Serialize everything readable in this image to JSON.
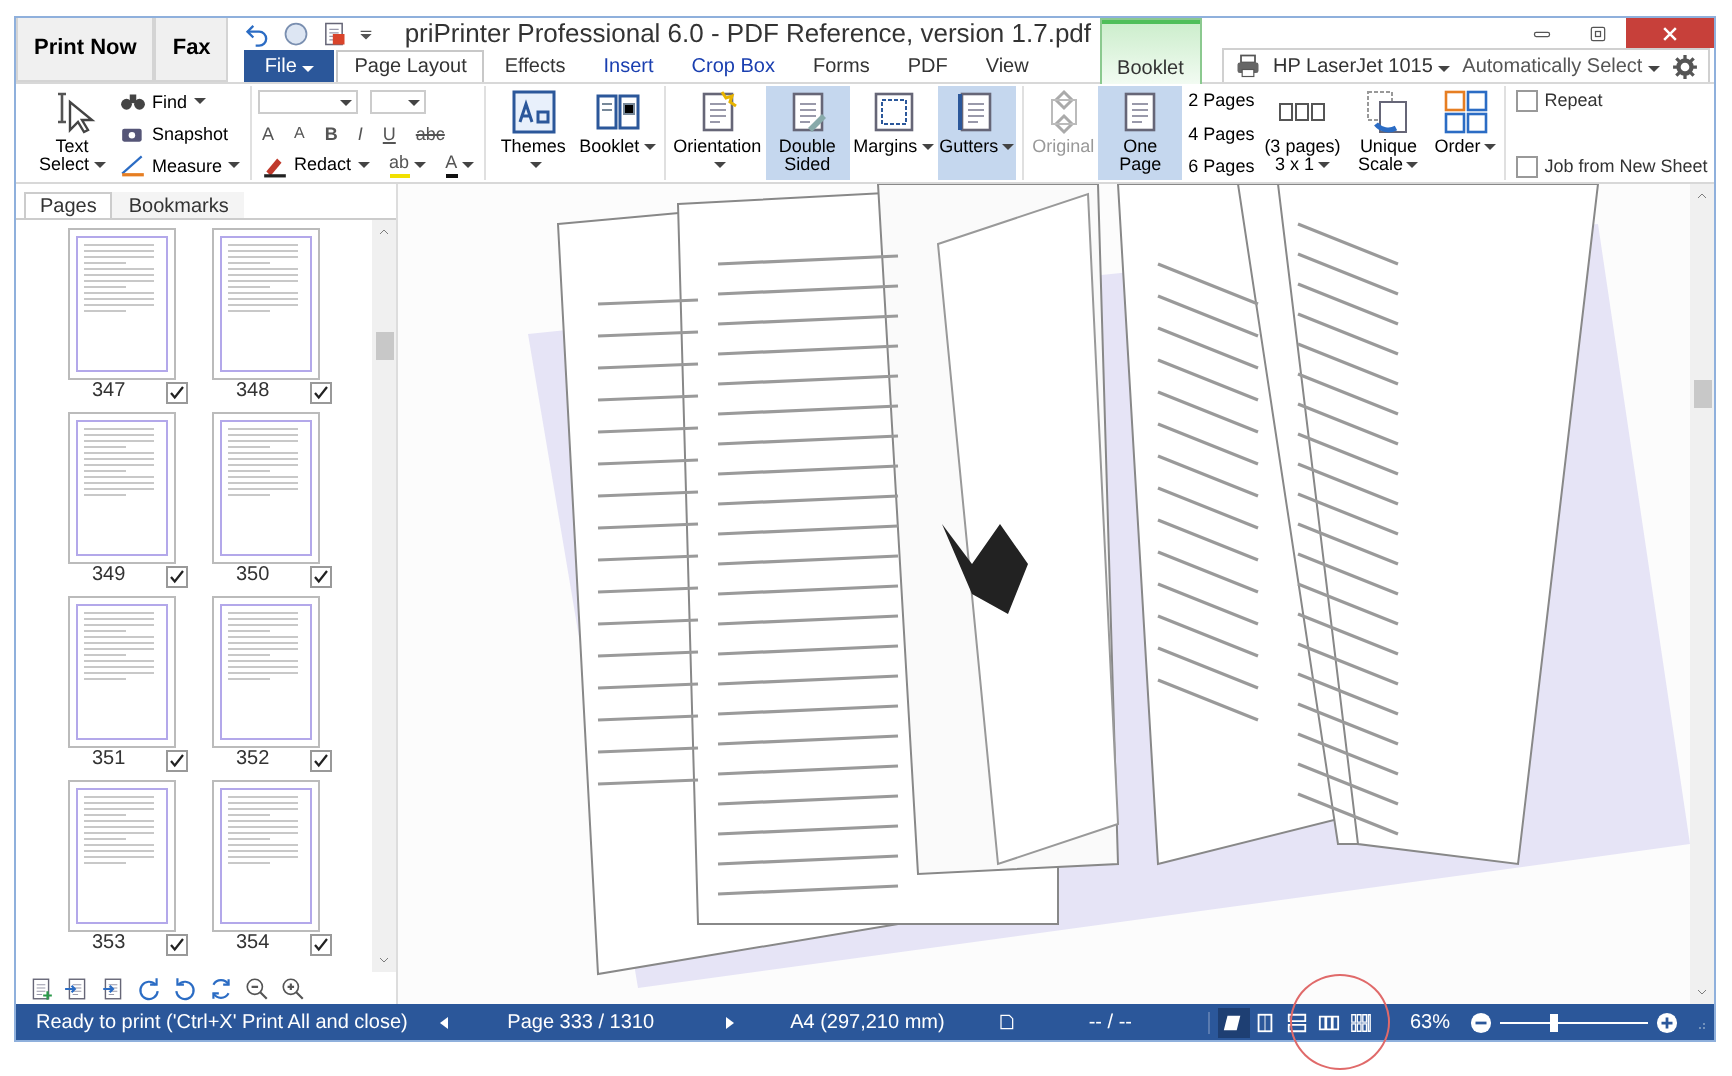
{
  "quick_buttons": [
    "Print Now",
    "Fax"
  ],
  "window": {
    "title": "priPrinter Professional 6.0 - PDF Reference, version 1.7.pdf"
  },
  "tabs": [
    {
      "label": "File",
      "kind": "menu",
      "selected": false
    },
    {
      "label": "Page Layout",
      "kind": "tab",
      "selected": true
    },
    {
      "label": "Effects",
      "kind": "tab",
      "selected": false
    },
    {
      "label": "Insert",
      "kind": "tab",
      "selected": false
    },
    {
      "label": "Crop Box",
      "kind": "tab",
      "selected": false
    },
    {
      "label": "Forms",
      "kind": "tab",
      "selected": false
    },
    {
      "label": "PDF",
      "kind": "tab",
      "selected": false
    },
    {
      "label": "View",
      "kind": "tab",
      "selected": false
    },
    {
      "label": "Booklet",
      "kind": "context",
      "selected": false
    }
  ],
  "printer": {
    "name": "HP LaserJet 1015",
    "tray": "Automatically Select"
  },
  "ribbon": {
    "groups": [
      {
        "items": [
          {
            "kind": "large",
            "label": "Text Select",
            "dropdown": true
          },
          {
            "kind": "small",
            "label": "Find",
            "dropdown": true
          },
          {
            "kind": "small",
            "label": "Snapshot",
            "dropdown": false
          },
          {
            "kind": "small",
            "label": "Measure",
            "dropdown": true
          }
        ]
      },
      {
        "font_boxes": [
          {
            "dropdown": true
          },
          {
            "dropdown": true
          }
        ],
        "format_buttons": [
          {
            "label": "A"
          },
          {
            "label": "A"
          },
          {
            "label": "B"
          },
          {
            "label": "I"
          },
          {
            "label": "U"
          },
          {
            "label": "abc"
          }
        ],
        "text_tools": [
          {
            "kind": "small",
            "label": "Redact",
            "dropdown": true
          },
          {
            "kind": "glyph",
            "label": "ab",
            "dropdown": true
          },
          {
            "kind": "glyph",
            "label": "A",
            "dropdown": true
          }
        ]
      },
      {
        "items": [
          {
            "kind": "large",
            "label": "Themes",
            "dropdown": true
          },
          {
            "kind": "large",
            "label": "Booklet",
            "dropdown": true
          }
        ]
      },
      {
        "items": [
          {
            "kind": "large",
            "label": "Orientation",
            "dropdown": true,
            "selected": false
          },
          {
            "kind": "large",
            "label": "Double Sided",
            "dropdown": false,
            "selected": true
          },
          {
            "kind": "large",
            "label": "Margins",
            "dropdown": true,
            "selected": false
          },
          {
            "kind": "large",
            "label": "Gutters",
            "dropdown": true,
            "selected": true
          }
        ]
      },
      {
        "items": [
          {
            "kind": "large",
            "label": "Original",
            "dropdown": false,
            "selected": false,
            "disabled": true
          },
          {
            "kind": "large",
            "label": "One Page",
            "dropdown": false,
            "selected": true,
            "disabled": false
          },
          {
            "kind": "small",
            "label": "2 Pages"
          },
          {
            "kind": "small",
            "label": "4 Pages"
          },
          {
            "kind": "small",
            "label": "6 Pages"
          },
          {
            "kind": "large",
            "label": "(3 pages) 3 x 1",
            "dropdown": true
          },
          {
            "kind": "large",
            "label": "Unique Scale",
            "dropdown": true
          },
          {
            "kind": "large",
            "label": "Order",
            "dropdown": true
          }
        ]
      },
      {
        "items": [
          {
            "kind": "check",
            "label": "Repeat",
            "checked": false
          },
          {
            "kind": "check",
            "label": "Job from New Sheet",
            "checked": false
          }
        ]
      }
    ]
  },
  "side_tabs": [
    {
      "label": "Pages",
      "selected": true
    },
    {
      "label": "Bookmarks",
      "selected": false
    }
  ],
  "thumbnails": [
    {
      "page": "347",
      "checked": true
    },
    {
      "page": "348",
      "checked": true
    },
    {
      "page": "349",
      "checked": true
    },
    {
      "page": "350",
      "checked": true
    },
    {
      "page": "351",
      "checked": true
    },
    {
      "page": "352",
      "checked": true
    },
    {
      "page": "353",
      "checked": true
    },
    {
      "page": "354",
      "checked": true
    }
  ],
  "status_bar": {
    "message": "Ready to print ('Ctrl+X' Print All and close)",
    "page": "Page 333 / 1310",
    "paper": "A4 (297,210 mm)",
    "position": "-- / --",
    "view_modes": [
      {
        "selected": true
      },
      {
        "selected": false
      },
      {
        "selected": false
      },
      {
        "selected": false
      },
      {
        "selected": false
      }
    ],
    "zoom": "63%",
    "zoom_slider": {
      "level": 0.36
    }
  }
}
